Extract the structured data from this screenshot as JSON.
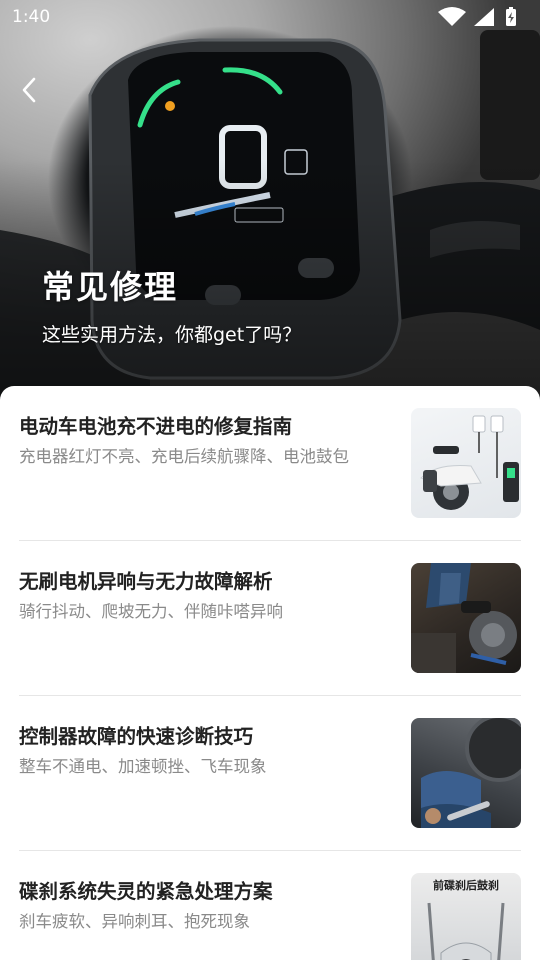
{
  "status_bar": {
    "time": "1:40",
    "icons": [
      "wifi-icon",
      "cellular-signal-icon",
      "battery-charging-icon"
    ]
  },
  "header": {
    "back_icon": "chevron-left-icon",
    "title": "常见修理",
    "subtitle": "这些实用方法，你都get了吗？"
  },
  "articles": [
    {
      "title": "电动车电池充不进电的修复指南",
      "description": "充电器红灯不亮、充电后续航骤降、电池鼓包"
    },
    {
      "title": "无刷电机异响与无力故障解析",
      "description": "骑行抖动、爬坡无力、伴随咔嗒异响"
    },
    {
      "title": "控制器故障的快速诊断技巧",
      "description": "整车不通电、加速顿挫、飞车现象"
    },
    {
      "title": "碟刹系统失灵的紧急处理方案",
      "description": "刹车疲软、异响刺耳、抱死现象",
      "thumb_caption": "前碟刹后鼓刹"
    }
  ],
  "colors": {
    "title_text": "#222222",
    "desc_text": "#8a8a8a",
    "divider": "#e6e6e6",
    "dashboard_green": "#35e08a"
  }
}
